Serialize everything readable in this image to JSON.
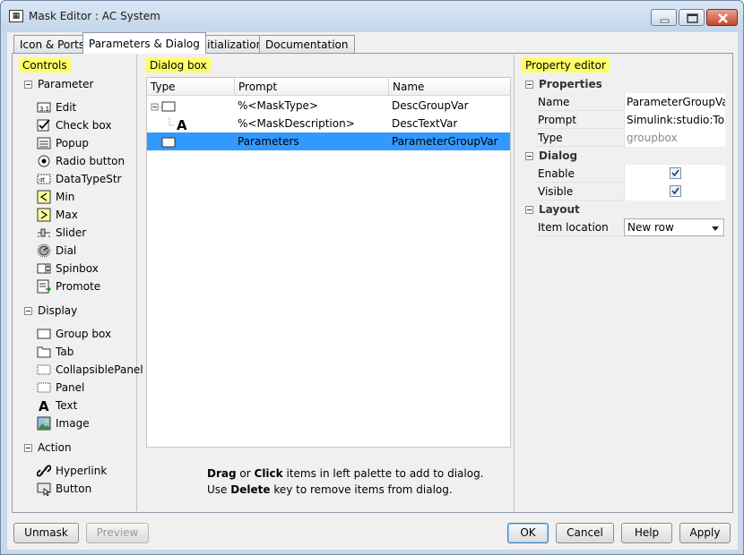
{
  "window": {
    "title": "Mask Editor : AC System",
    "controls": {
      "minimize": "minimize",
      "maximize": "maximize",
      "close": "close"
    }
  },
  "tabs": [
    {
      "label": "Icon & Ports"
    },
    {
      "label": "Parameters & Dialog"
    },
    {
      "label": "Initialization"
    },
    {
      "label": "Documentation"
    }
  ],
  "controls_pane": {
    "title": "Controls",
    "groups": [
      {
        "label": "Parameter",
        "items": [
          {
            "label": "Edit",
            "icon": "edit-icon"
          },
          {
            "label": "Check box",
            "icon": "checkbox-icon"
          },
          {
            "label": "Popup",
            "icon": "popup-icon"
          },
          {
            "label": "Radio button",
            "icon": "radio-button-icon"
          },
          {
            "label": "DataTypeStr",
            "icon": "datatype-icon"
          },
          {
            "label": "Min",
            "icon": "min-icon"
          },
          {
            "label": "Max",
            "icon": "max-icon"
          },
          {
            "label": "Slider",
            "icon": "slider-icon"
          },
          {
            "label": "Dial",
            "icon": "dial-icon"
          },
          {
            "label": "Spinbox",
            "icon": "spinbox-icon"
          },
          {
            "label": "Promote",
            "icon": "promote-icon"
          }
        ]
      },
      {
        "label": "Display",
        "items": [
          {
            "label": "Group box",
            "icon": "group-box-icon"
          },
          {
            "label": "Tab",
            "icon": "tab-icon"
          },
          {
            "label": "CollapsiblePanel",
            "icon": "collapsible-panel-icon"
          },
          {
            "label": "Panel",
            "icon": "panel-icon"
          },
          {
            "label": "Text",
            "icon": "text-icon"
          },
          {
            "label": "Image",
            "icon": "image-icon"
          }
        ]
      },
      {
        "label": "Action",
        "items": [
          {
            "label": "Hyperlink",
            "icon": "hyperlink-icon"
          },
          {
            "label": "Button",
            "icon": "button-icon"
          }
        ]
      }
    ]
  },
  "dialog_box": {
    "title": "Dialog box",
    "columns": [
      "Type",
      "Prompt",
      "Name"
    ],
    "rows": [
      {
        "prompt": "%<MaskType>",
        "name": "DescGroupVar",
        "icon": "group-box-icon"
      },
      {
        "prompt": "%<MaskDescription>",
        "name": "DescTextVar",
        "icon": "text-icon"
      },
      {
        "prompt": "Parameters",
        "name": "ParameterGroupVar",
        "icon": "group-box-icon"
      }
    ],
    "hint": {
      "drag": "Drag",
      "or": "or",
      "click": "Click",
      "line1_rest": "items in left palette to add to dialog.",
      "use": "Use",
      "delete": "Delete",
      "line2_rest": "key to remove items from dialog."
    }
  },
  "property_editor": {
    "title": "Property editor",
    "sections": {
      "properties": "Properties",
      "dialog": "Dialog",
      "layout": "Layout"
    },
    "properties": [
      {
        "key": "Name",
        "value": "ParameterGroupVar"
      },
      {
        "key": "Prompt",
        "value": "Simulink:studio:To..."
      },
      {
        "key": "Type",
        "value": "groupbox"
      }
    ],
    "dialog": [
      {
        "key": "Enable",
        "checked": true
      },
      {
        "key": "Visible",
        "checked": true
      }
    ],
    "layout": [
      {
        "key": "Item location",
        "value": "New row"
      }
    ]
  },
  "buttons": {
    "unmask": "Unmask",
    "preview": "Preview",
    "ok": "OK",
    "cancel": "Cancel",
    "help": "Help",
    "apply": "Apply"
  },
  "colors": {
    "selection": "#3399ff",
    "highlight": "#ffff66",
    "titlebar": "#c9d9ec"
  }
}
